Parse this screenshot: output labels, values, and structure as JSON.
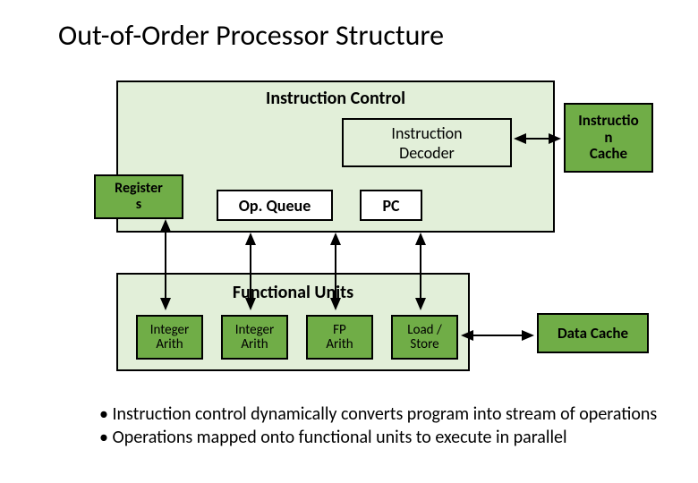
{
  "title": "Out-of-Order Processor Structure",
  "instruction_control": {
    "label": "Instruction Control",
    "decoder": "Instruction\nDecoder",
    "op_queue": "Op. Queue",
    "pc": "PC"
  },
  "registers": "Register\ns",
  "icache": "Instructio\nn\nCache",
  "functional_units": {
    "label": "Functional Units",
    "units": [
      "Integer\nArith",
      "Integer\nArith",
      "FP\nArith",
      "Load /\nStore"
    ]
  },
  "dcache": "Data Cache",
  "bullets": [
    "Instruction control dynamically converts program into stream of operations",
    "Operations mapped onto functional units to execute in parallel"
  ],
  "colors": {
    "group_bg": "#e2efd9",
    "block_bg": "#70ad47"
  }
}
